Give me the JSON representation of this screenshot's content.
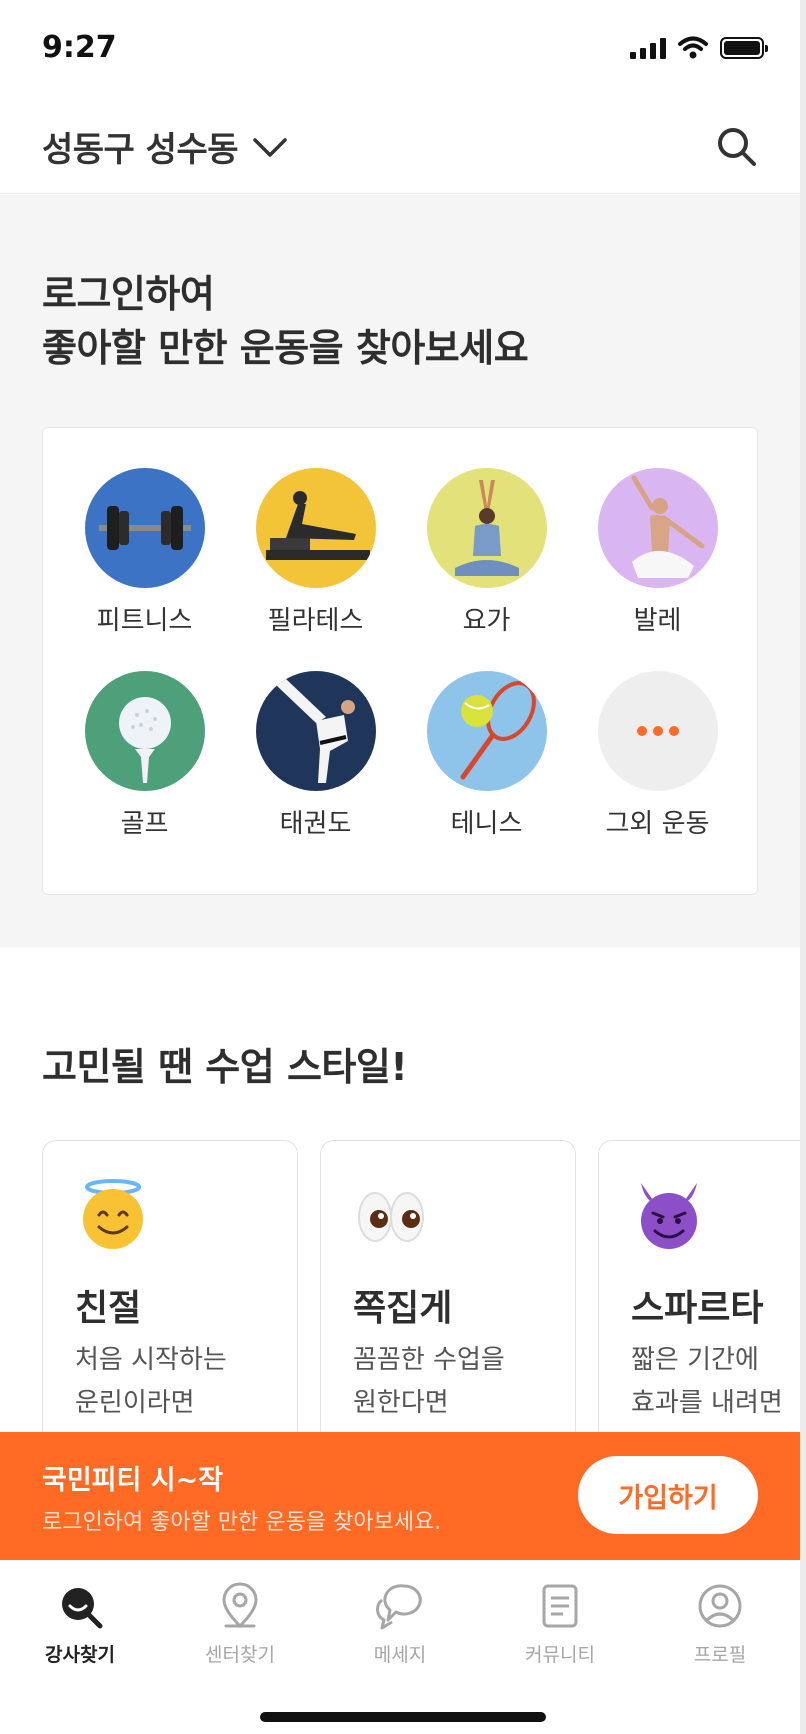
{
  "status_bar": {
    "time": "9:27"
  },
  "header": {
    "location": "성동구 성수동"
  },
  "hero": {
    "title_line1": "로그인하여",
    "title_line2": "좋아할 만한 운동을 찾아보세요"
  },
  "categories": [
    {
      "label": "피트니스",
      "icon": "dumbbell-icon",
      "color": "#3d73c4"
    },
    {
      "label": "필라테스",
      "icon": "pilates-reformer-icon",
      "color": "#f3c437"
    },
    {
      "label": "요가",
      "icon": "yoga-pose-icon",
      "color": "#e3e27a"
    },
    {
      "label": "발레",
      "icon": "ballet-dancer-icon",
      "color": "#d9b6f2"
    },
    {
      "label": "골프",
      "icon": "golf-ball-icon",
      "color": "#4ea07a"
    },
    {
      "label": "태권도",
      "icon": "taekwondo-kick-icon",
      "color": "#1f3559"
    },
    {
      "label": "테니스",
      "icon": "tennis-racket-icon",
      "color": "#8ec3ea"
    },
    {
      "label": "그외 운동",
      "icon": "more-dots-icon",
      "color": "#eeeeee"
    }
  ],
  "styles": {
    "title": "고민될 땐 수업 스타일!",
    "cards": [
      {
        "name": "친절",
        "desc_line1": "처음 시작하는",
        "desc_line2": "운린이라면",
        "icon": "angel-face-icon"
      },
      {
        "name": "쪽집게",
        "desc_line1": "꼼꼼한 수업을",
        "desc_line2": "원한다면",
        "icon": "eyes-icon"
      },
      {
        "name": "스파르타",
        "desc_line1": "짧은 기간에",
        "desc_line2": "효과를 내려면",
        "icon": "devil-face-icon"
      }
    ]
  },
  "banner": {
    "title": "국민피티 시~작",
    "subtitle": "로그인하여 좋아할 만한 운동을 찾아보세요.",
    "button": "가입하기",
    "color": "#ff6a25"
  },
  "bottom_nav": [
    {
      "label": "강사찾기",
      "icon": "instructor-search-icon",
      "active": true
    },
    {
      "label": "센터찾기",
      "icon": "location-pin-icon",
      "active": false
    },
    {
      "label": "메세지",
      "icon": "chat-bubble-icon",
      "active": false
    },
    {
      "label": "커뮤니티",
      "icon": "document-icon",
      "active": false
    },
    {
      "label": "프로필",
      "icon": "profile-icon",
      "active": false
    }
  ]
}
